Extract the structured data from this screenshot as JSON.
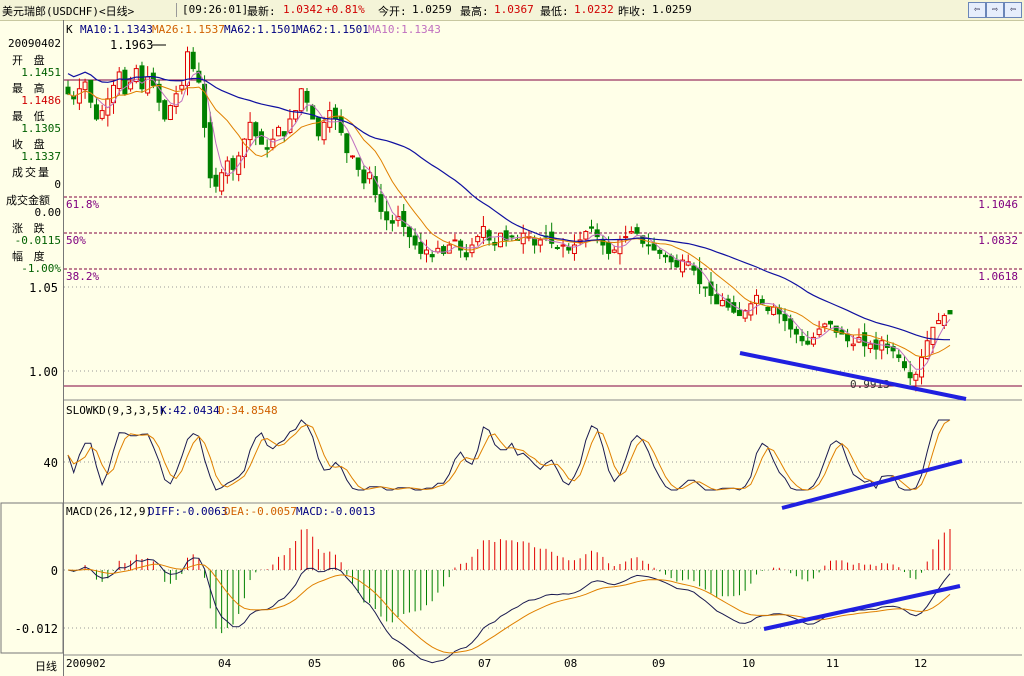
{
  "header": {
    "instrument": "美元瑞郎(USDCHF)<日线>",
    "time": "[09:26:01]",
    "latest_label": "最新:",
    "latest_value": "1.0342",
    "change": "+0.81%",
    "open_label": "今开:",
    "open_value": "1.0259",
    "high_label": "最高:",
    "high_value": "1.0367",
    "low_label": "最低:",
    "low_value": "1.0232",
    "prev_label": "昨收:",
    "prev_value": "1.0259",
    "buttons": [
      "⇦",
      "⇨",
      "⇦"
    ]
  },
  "side_panel": {
    "date": "20090402",
    "open_label": "开 盘",
    "open": "1.1451",
    "high_label": "最 高",
    "high": "1.1486",
    "low_label": "最 低",
    "low": "1.1305",
    "close_label": "收 盘",
    "close": "1.1337",
    "volume_label": "成交量",
    "volume": "0",
    "amount_label": "成交金额",
    "amount": "0.00",
    "change_label": "涨 跌",
    "change": "-0.0115",
    "range_label": "幅 度",
    "range": "-1.00%",
    "period_label": "日线"
  },
  "indicators": {
    "ma_prefix": "K",
    "ma10": "MA10:1.1343",
    "ma26": "MA26:1.1537",
    "ma62a": "MA62:1.1501",
    "ma62b": "MA62:1.1501",
    "ma10b": "MA10:1.1343",
    "kd_name": "SLOWKD(9,3,3,5)",
    "kd_k": "K:42.0434",
    "kd_d": "D:34.8548",
    "macd_name": "MACD(26,12,9)",
    "macd_diff": "DIFF:-0.0063",
    "macd_dea": "DEA:-0.0057",
    "macd_macd": "MACD:-0.0013"
  },
  "colors": {
    "up": "#e00000",
    "down": "#008000",
    "ma10": "#c070c0",
    "ma26": "#e08000",
    "ma62": "#1010a0",
    "k_line": "#1a1a50",
    "d_line": "#e08000",
    "trend": "#2020e0",
    "fib": "#800040"
  },
  "chart_data": [
    {
      "type": "candlestick",
      "x_ticks": [
        "200902",
        "04",
        "05",
        "06",
        "07",
        "08",
        "09",
        "10",
        "11",
        "12"
      ],
      "y_ticks": [
        "1.05",
        "1.00"
      ],
      "annotations": {
        "high_label": "1.1963",
        "low_label": "0.9913"
      },
      "fib_levels": [
        {
          "pct": "61.8%",
          "value": "1.1046",
          "price": 1.1046
        },
        {
          "pct": "50%",
          "value": "1.0832",
          "price": 1.0832
        },
        {
          "pct": "38.2%",
          "value": "1.0618",
          "price": 1.0618
        }
      ],
      "fib_extent": {
        "top": 1.1963,
        "bottom": 0.9913
      },
      "ylim": [
        0.98,
        1.22
      ],
      "closes": [
        1.165,
        1.162,
        1.168,
        1.172,
        1.16,
        1.15,
        1.155,
        1.162,
        1.17,
        1.178,
        1.165,
        1.172,
        1.18,
        1.168,
        1.175,
        1.17,
        1.16,
        1.15,
        1.158,
        1.165,
        1.17,
        1.19,
        1.18,
        1.172,
        1.145,
        1.115,
        1.11,
        1.118,
        1.125,
        1.12,
        1.128,
        1.138,
        1.148,
        1.14,
        1.135,
        1.132,
        1.138,
        1.145,
        1.14,
        1.15,
        1.155,
        1.168,
        1.16,
        1.15,
        1.14,
        1.148,
        1.155,
        1.15,
        1.142,
        1.13,
        1.128,
        1.12,
        1.112,
        1.118,
        1.105,
        1.095,
        1.09,
        1.088,
        1.092,
        1.086,
        1.08,
        1.075,
        1.07,
        1.072,
        1.068,
        1.073,
        1.07,
        1.075,
        1.078,
        1.072,
        1.068,
        1.075,
        1.08,
        1.086,
        1.078,
        1.075,
        1.082,
        1.078,
        1.08,
        1.078,
        1.082,
        1.08,
        1.075,
        1.078,
        1.08,
        1.076,
        1.073,
        1.075,
        1.072,
        1.075,
        1.078,
        1.083,
        1.085,
        1.08,
        1.075,
        1.07,
        1.072,
        1.078,
        1.08,
        1.083,
        1.082,
        1.076,
        1.075,
        1.072,
        1.07,
        1.068,
        1.065,
        1.062,
        1.066,
        1.065,
        1.06,
        1.052,
        1.05,
        1.045,
        1.04,
        1.042,
        1.038,
        1.035,
        1.033,
        1.036,
        1.04,
        1.045,
        1.04,
        1.036,
        1.038,
        1.034,
        1.03,
        1.025,
        1.022,
        1.018,
        1.016,
        1.02,
        1.025,
        1.028,
        1.028,
        1.023,
        1.022,
        1.018,
        1.016,
        1.02,
        1.015,
        1.016,
        1.013,
        1.018,
        1.014,
        1.012,
        1.008,
        1.002,
        0.996,
        0.998,
        1.008,
        1.018,
        1.026,
        1.03,
        1.033,
        1.034
      ],
      "overlays": [
        "MA10",
        "MA26",
        "MA62"
      ]
    },
    {
      "type": "line",
      "name": "SLOWKD",
      "y_ticks": [
        "40"
      ],
      "ylim": [
        0,
        100
      ]
    },
    {
      "type": "bar+line",
      "name": "MACD",
      "y_ticks": [
        "0",
        "-0.012"
      ],
      "ylim": [
        -0.018,
        0.012
      ]
    }
  ]
}
